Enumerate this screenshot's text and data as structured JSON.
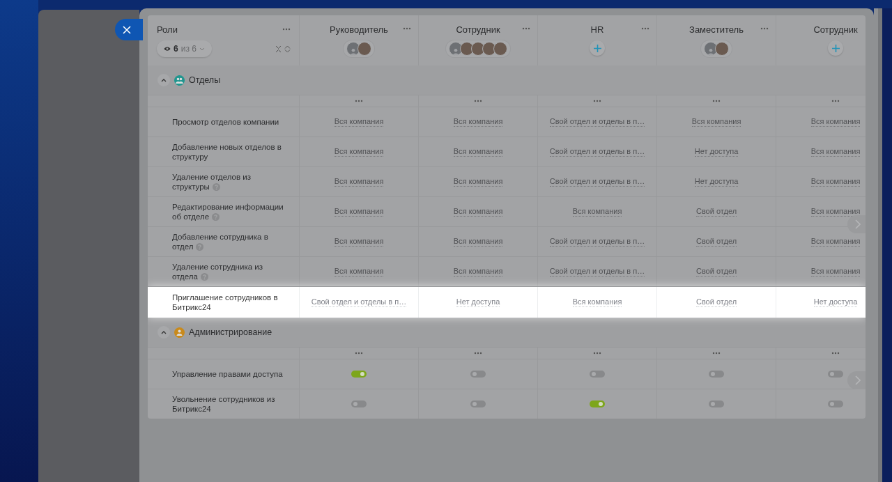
{
  "table": {
    "header": {
      "title": "Роли",
      "filter": {
        "count": "6",
        "of": "из 6"
      }
    },
    "roles": [
      {
        "name": "Руководитель",
        "members": [
          {
            "kind": "silhouette"
          },
          {
            "kind": "photo"
          }
        ]
      },
      {
        "name": "Сотрудник",
        "members": [
          {
            "kind": "silhouette"
          },
          {
            "kind": "photo"
          },
          {
            "kind": "photo"
          },
          {
            "kind": "photo"
          },
          {
            "kind": "photo"
          }
        ]
      },
      {
        "name": "HR"
      },
      {
        "name": "Заместитель",
        "members": [
          {
            "kind": "silhouette"
          },
          {
            "kind": "photo"
          }
        ]
      },
      {
        "name": "Сотрудник"
      }
    ],
    "sections": [
      {
        "title": "Отделы",
        "color": "#21968f",
        "expanded": true,
        "rows": [
          {
            "label": "Просмотр отделов компании",
            "help": false,
            "highlighted": false,
            "values": [
              {
                "kind": "text",
                "text": "Вся компания"
              },
              {
                "kind": "text",
                "text": "Вся компания"
              },
              {
                "kind": "text",
                "text": "Свой отдел и отделы в п…"
              },
              {
                "kind": "text",
                "text": "Вся компания"
              },
              {
                "kind": "text",
                "text": "Вся компания"
              }
            ]
          },
          {
            "label": "Добавление новых отделов в структуру",
            "help": false,
            "highlighted": false,
            "values": [
              {
                "kind": "text",
                "text": "Вся компания"
              },
              {
                "kind": "text",
                "text": "Вся компания"
              },
              {
                "kind": "text",
                "text": "Свой отдел и отделы в п…"
              },
              {
                "kind": "text",
                "text": "Нет доступа"
              },
              {
                "kind": "text",
                "text": "Вся компания"
              }
            ]
          },
          {
            "label": "Удаление отделов из структуры",
            "help": true,
            "highlighted": false,
            "values": [
              {
                "kind": "text",
                "text": "Вся компания"
              },
              {
                "kind": "text",
                "text": "Вся компания"
              },
              {
                "kind": "text",
                "text": "Свой отдел и отделы в п…"
              },
              {
                "kind": "text",
                "text": "Нет доступа"
              },
              {
                "kind": "text",
                "text": "Вся компания"
              }
            ]
          },
          {
            "label": "Редактирование информации об отделе",
            "help": true,
            "highlighted": false,
            "values": [
              {
                "kind": "text",
                "text": "Вся компания"
              },
              {
                "kind": "text",
                "text": "Вся компания"
              },
              {
                "kind": "text",
                "text": "Вся компания"
              },
              {
                "kind": "text",
                "text": "Свой отдел"
              },
              {
                "kind": "text",
                "text": "Вся компания"
              }
            ]
          },
          {
            "label": "Добавление сотрудника в отдел",
            "help": true,
            "highlighted": false,
            "values": [
              {
                "kind": "text",
                "text": "Вся компания"
              },
              {
                "kind": "text",
                "text": "Вся компания"
              },
              {
                "kind": "text",
                "text": "Свой отдел и отделы в п…"
              },
              {
                "kind": "text",
                "text": "Свой отдел"
              },
              {
                "kind": "text",
                "text": "Вся компания"
              }
            ]
          },
          {
            "label": "Удаление сотрудника из отдела",
            "help": true,
            "highlighted": false,
            "values": [
              {
                "kind": "text",
                "text": "Вся компания"
              },
              {
                "kind": "text",
                "text": "Вся компания"
              },
              {
                "kind": "text",
                "text": "Свой отдел и отделы в п…"
              },
              {
                "kind": "text",
                "text": "Свой отдел"
              },
              {
                "kind": "text",
                "text": "Вся компания"
              }
            ]
          },
          {
            "label": "Приглашение сотрудников в Битрикс24",
            "help": false,
            "highlighted": true,
            "values": [
              {
                "kind": "text",
                "text": "Свой отдел и отделы в п…"
              },
              {
                "kind": "text",
                "text": "Нет доступа"
              },
              {
                "kind": "text",
                "text": "Вся компания"
              },
              {
                "kind": "text",
                "text": "Свой отдел"
              },
              {
                "kind": "text",
                "text": "Нет доступа"
              }
            ]
          }
        ]
      },
      {
        "title": "Администрирование",
        "color": "#c98a1c",
        "expanded": true,
        "rows": [
          {
            "label": "Управление правами доступа",
            "help": false,
            "highlighted": false,
            "values": [
              {
                "kind": "toggle",
                "on": true
              },
              {
                "kind": "toggle",
                "on": false
              },
              {
                "kind": "toggle",
                "on": false
              },
              {
                "kind": "toggle",
                "on": false
              },
              {
                "kind": "toggle",
                "on": false
              }
            ]
          },
          {
            "label": "Увольнение сотрудников из Битрикс24",
            "help": false,
            "highlighted": false,
            "values": [
              {
                "kind": "toggle",
                "on": false
              },
              {
                "kind": "toggle",
                "on": false
              },
              {
                "kind": "toggle",
                "on": true
              },
              {
                "kind": "toggle",
                "on": false
              },
              {
                "kind": "toggle",
                "on": false
              }
            ]
          }
        ]
      }
    ]
  }
}
